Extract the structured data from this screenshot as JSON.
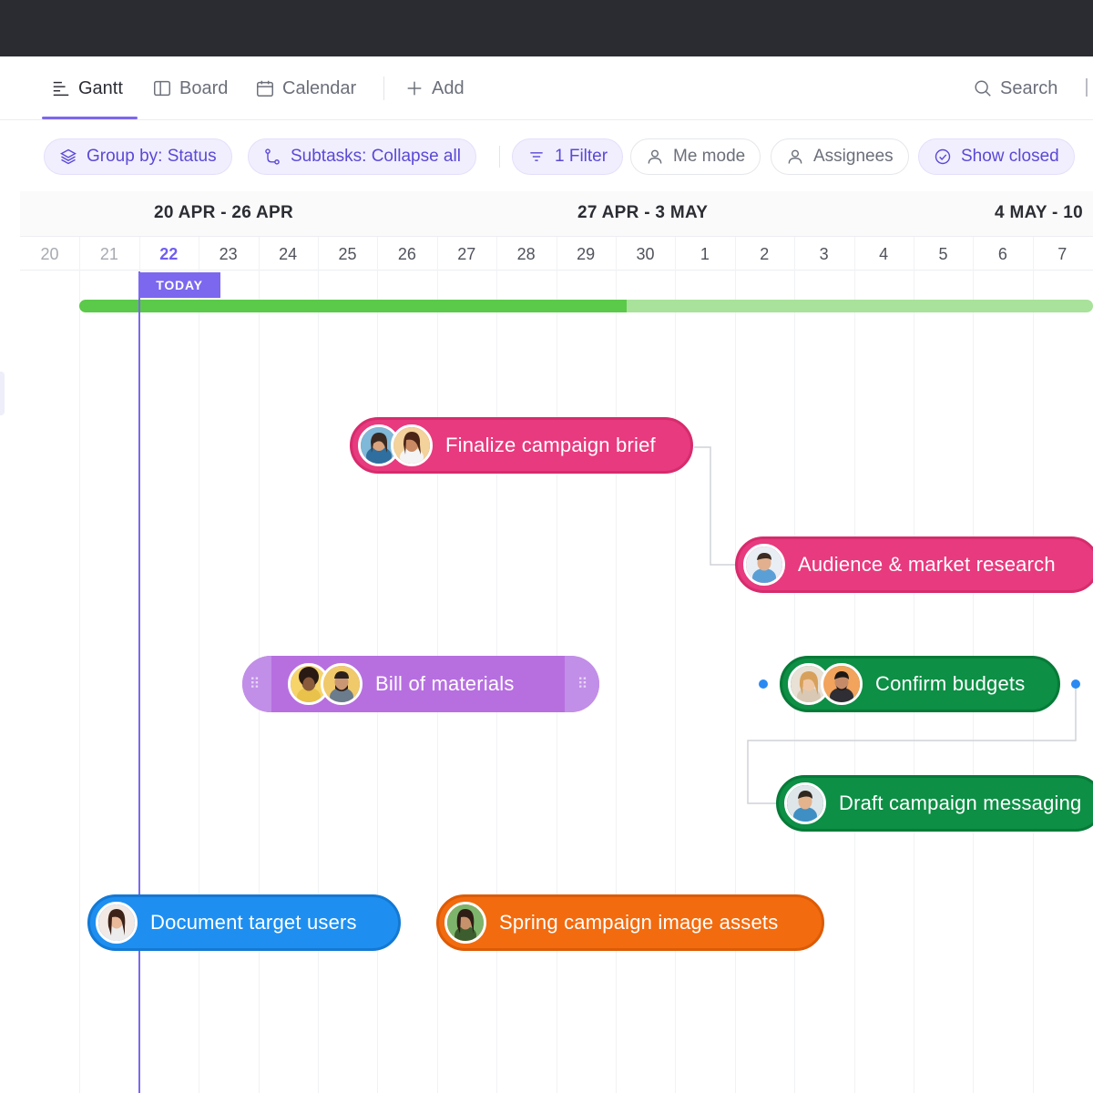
{
  "views": {
    "tabs": [
      {
        "label": "Gantt",
        "icon": "gantt-icon",
        "active": true
      },
      {
        "label": "Board",
        "icon": "board-icon"
      },
      {
        "label": "Calendar",
        "icon": "calendar-icon"
      },
      {
        "label": "Add",
        "icon": "plus-icon"
      }
    ],
    "search_label": "Search"
  },
  "filters": {
    "group_by": "Group by: Status",
    "subtasks": "Subtasks: Collapse all",
    "filter": "1 Filter",
    "me_mode": "Me mode",
    "assignees": "Assignees",
    "show_closed": "Show closed"
  },
  "timeline": {
    "weeks": [
      "20 APR - 26 APR",
      "27 APR - 3 MAY",
      "4 MAY - 10"
    ],
    "days": [
      "20",
      "21",
      "22",
      "23",
      "24",
      "25",
      "26",
      "27",
      "28",
      "29",
      "30",
      "1",
      "2",
      "3",
      "4",
      "5",
      "6",
      "7"
    ],
    "today_label": "TODAY",
    "progress_fraction": 0.54
  },
  "tasks": [
    {
      "name": "Finalize campaign brief",
      "color": "#e83a7e"
    },
    {
      "name": "Audience & market research",
      "color": "#e83a7e"
    },
    {
      "name": "Bill of materials",
      "color": "#b76fe0"
    },
    {
      "name": "Confirm budgets",
      "color": "#0d8f45"
    },
    {
      "name": "Draft campaign messaging",
      "color": "#0d8f45"
    },
    {
      "name": "Document target users",
      "color": "#1e8ff0"
    },
    {
      "name": "Spring campaign image assets",
      "color": "#f26b0f"
    }
  ],
  "colors": {
    "accent": "#7b68ee",
    "progress_done": "#5bc94a",
    "progress_remaining": "#a8e29b"
  }
}
